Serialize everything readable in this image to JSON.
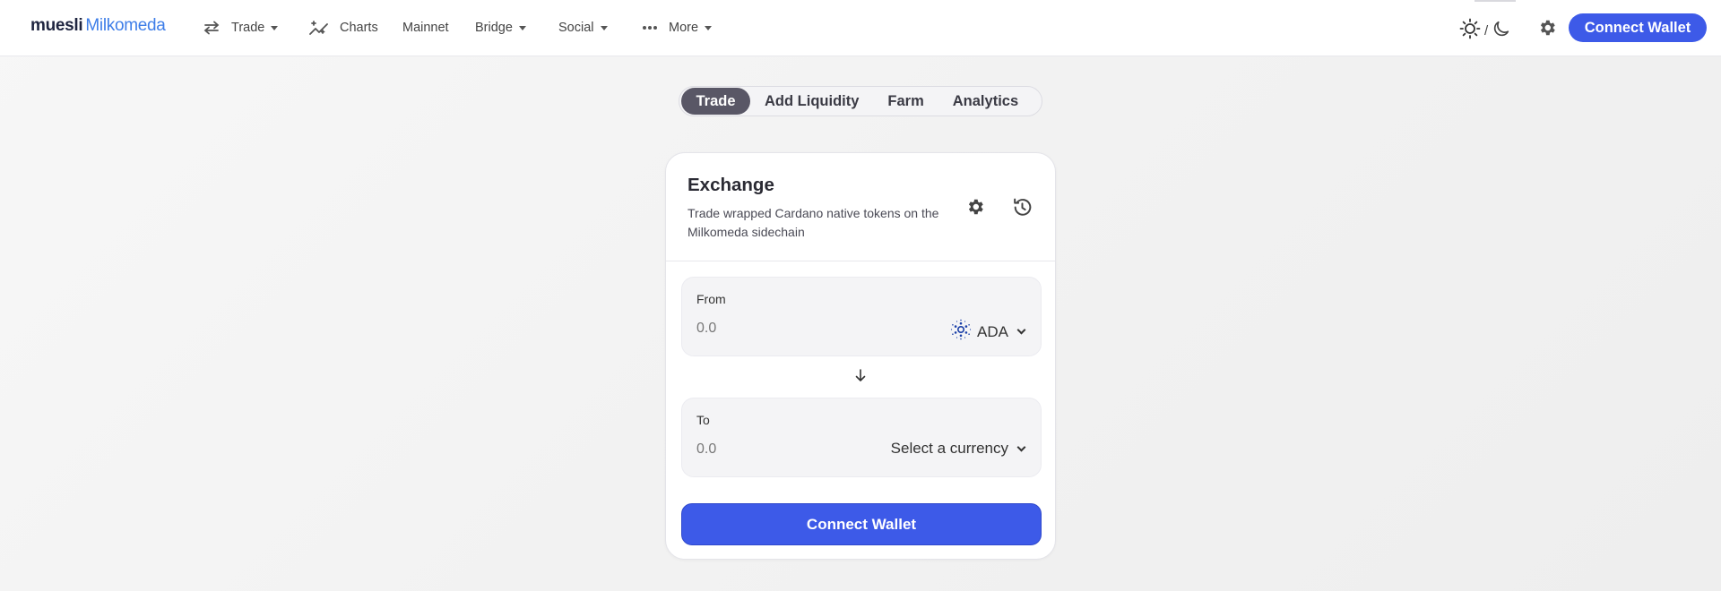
{
  "brand": {
    "part1": "muesli",
    "part2": "Milkomeda"
  },
  "nav": {
    "trade": "Trade",
    "charts": "Charts",
    "mainnet": "Mainnet",
    "bridge": "Bridge",
    "social": "Social",
    "more": "More",
    "theme_separator": "/",
    "connect_wallet": "Connect Wallet"
  },
  "tabs": [
    {
      "label": "Trade",
      "active": true
    },
    {
      "label": "Add Liquidity",
      "active": false
    },
    {
      "label": "Farm",
      "active": false
    },
    {
      "label": "Analytics",
      "active": false
    }
  ],
  "exchange": {
    "title": "Exchange",
    "subtitle": "Trade wrapped Cardano native tokens on the Milkomeda sidechain",
    "from": {
      "label": "From",
      "placeholder": "0.0",
      "currency": "ADA"
    },
    "to": {
      "label": "To",
      "placeholder": "0.0",
      "currency": "Select a currency"
    },
    "connect_wallet": "Connect Wallet"
  },
  "colors": {
    "accent": "#3d5ae8",
    "brand_blue": "#3e7ee8",
    "active_tab": "#595766"
  },
  "icons": [
    "swap-arrows-icon",
    "sparkle-chart-icon",
    "more-dots-icon",
    "sun-icon",
    "moon-icon",
    "gear-icon",
    "history-icon",
    "cardano-icon",
    "arrow-down-icon"
  ]
}
